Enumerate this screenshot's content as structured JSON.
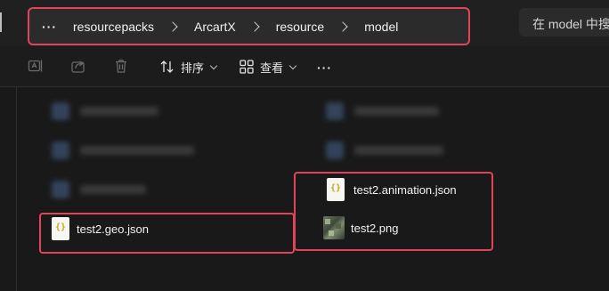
{
  "breadcrumb": {
    "more_label": "···",
    "items": [
      "resourcepacks",
      "ArcartX",
      "resource",
      "model"
    ]
  },
  "search": {
    "placeholder": "在 model 中搜索"
  },
  "toolbar": {
    "sort_label": "排序",
    "view_label": "查看",
    "more_label": "···",
    "icons": [
      "rename-icon",
      "share-icon",
      "delete-icon",
      "sort-icon",
      "view-icon"
    ]
  },
  "files": [
    {
      "name": "test2.animation.json",
      "icon": "json-file-icon"
    },
    {
      "name": "test2.png",
      "icon": "image-file-icon"
    },
    {
      "name": "test2.geo.json",
      "icon": "json-file-icon"
    }
  ],
  "json_icon_glyph": "{}",
  "colors": {
    "highlight": "#e0435a",
    "background": "#191919",
    "json_brace": "#c8a618"
  }
}
